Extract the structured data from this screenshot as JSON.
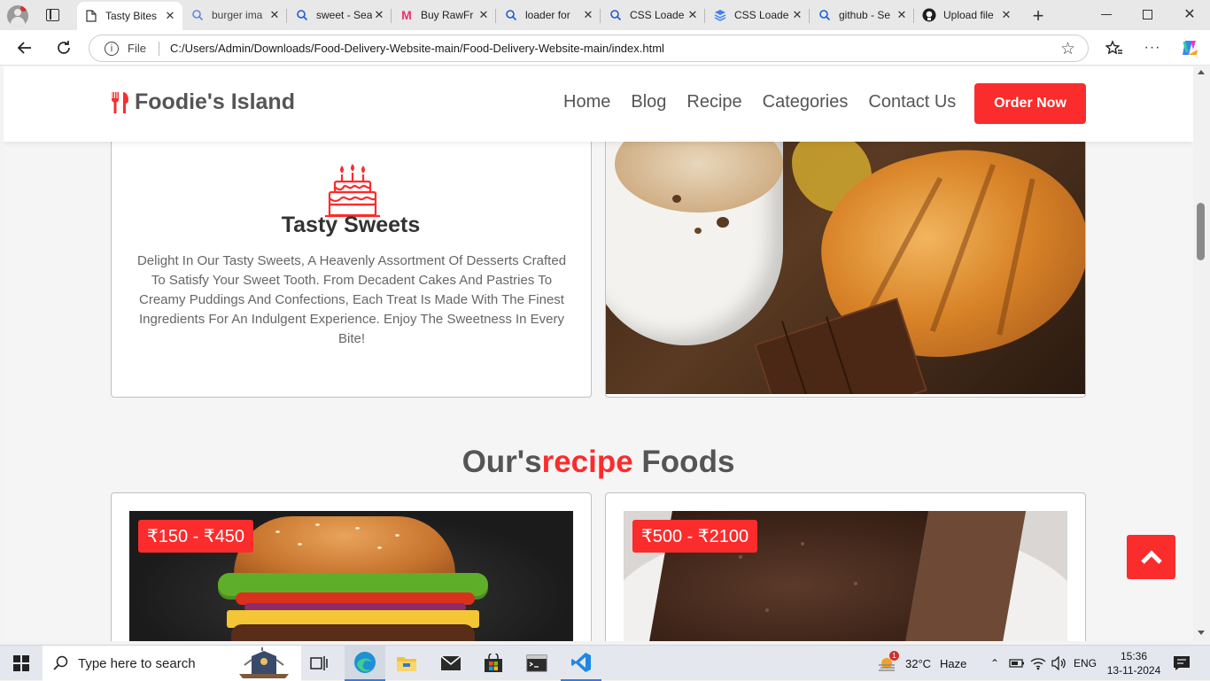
{
  "browser": {
    "tabs": [
      {
        "title": "Tasty Bites",
        "icon": "document-icon",
        "active": true
      },
      {
        "title": "burger ima",
        "icon": "search-icon"
      },
      {
        "title": "sweet - Sea",
        "icon": "search-icon"
      },
      {
        "title": "Buy RawFr",
        "icon": "myntra-icon"
      },
      {
        "title": "loader for",
        "icon": "search-icon"
      },
      {
        "title": "CSS Loade",
        "icon": "search-icon"
      },
      {
        "title": "CSS Loade",
        "icon": "layers-icon"
      },
      {
        "title": "github - Se",
        "icon": "search-icon"
      },
      {
        "title": "Upload file",
        "icon": "github-icon"
      }
    ],
    "address": {
      "scheme_label": "File",
      "url": "C:/Users/Admin/Downloads/Food-Delivery-Website-main/Food-Delivery-Website-main/index.html"
    }
  },
  "site": {
    "brand": "Foodie's Island",
    "nav": [
      "Home",
      "Blog",
      "Recipe",
      "Categories",
      "Contact Us"
    ],
    "order_button": "Order Now",
    "sweets_card": {
      "title": "Tasty Sweets",
      "description": "Delight In Our Tasty Sweets, A Heavenly Assortment Of Desserts Crafted To Satisfy Your Sweet Tooth. From Decadent Cakes And Pastries To Creamy Puddings And Confections, Each Treat Is Made With The Finest Ingredients For An Indulgent Experience. Enjoy The Sweetness In Every Bite!"
    },
    "recipe_heading": {
      "part1": "Our's",
      "highlight": "recipe",
      "part2": " Foods"
    },
    "recipes": [
      {
        "price": "₹150 - ₹450",
        "image": "burger-image"
      },
      {
        "price": "₹500 - ₹2100",
        "image": "chocolate-cake-image"
      }
    ],
    "accent_color": "#fb2c2c"
  },
  "taskbar": {
    "search_placeholder": "Type here to search",
    "weather": {
      "temp": "32°C",
      "condition": "Haze",
      "badge": "1"
    },
    "language": "ENG",
    "time": "15:36",
    "date": "13-11-2024"
  }
}
